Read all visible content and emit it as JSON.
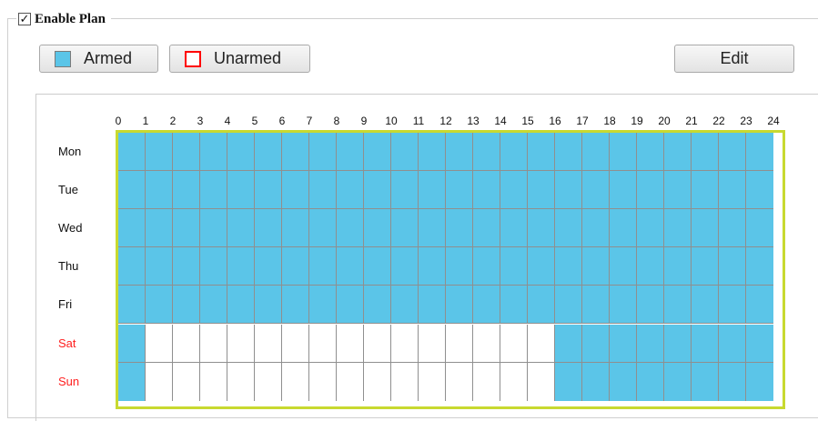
{
  "plan": {
    "enabled_check": "✓",
    "label": "Enable Plan"
  },
  "legend": {
    "armed_label": "Armed",
    "armed_color": "#5bc5e8",
    "unarmed_label": "Unarmed",
    "unarmed_color": "#ff0000"
  },
  "toolbar": {
    "edit_label": "Edit"
  },
  "schedule": {
    "hours": [
      "0",
      "1",
      "2",
      "3",
      "4",
      "5",
      "6",
      "7",
      "8",
      "9",
      "10",
      "11",
      "12",
      "13",
      "14",
      "15",
      "16",
      "17",
      "18",
      "19",
      "20",
      "21",
      "22",
      "23",
      "24"
    ],
    "days": [
      {
        "label": "Mon",
        "weekend": false,
        "armed": [
          [
            0,
            24
          ]
        ]
      },
      {
        "label": "Tue",
        "weekend": false,
        "armed": [
          [
            0,
            24
          ]
        ]
      },
      {
        "label": "Wed",
        "weekend": false,
        "armed": [
          [
            0,
            24
          ]
        ]
      },
      {
        "label": "Thu",
        "weekend": false,
        "armed": [
          [
            0,
            24
          ]
        ]
      },
      {
        "label": "Fri",
        "weekend": false,
        "armed": [
          [
            0,
            24
          ]
        ]
      },
      {
        "label": "Sat",
        "weekend": true,
        "armed": [
          [
            0,
            1
          ],
          [
            16,
            24
          ]
        ]
      },
      {
        "label": "Sun",
        "weekend": true,
        "armed": [
          [
            0,
            1
          ],
          [
            16,
            24
          ]
        ]
      }
    ],
    "grid_border_color": "#c8d930"
  }
}
